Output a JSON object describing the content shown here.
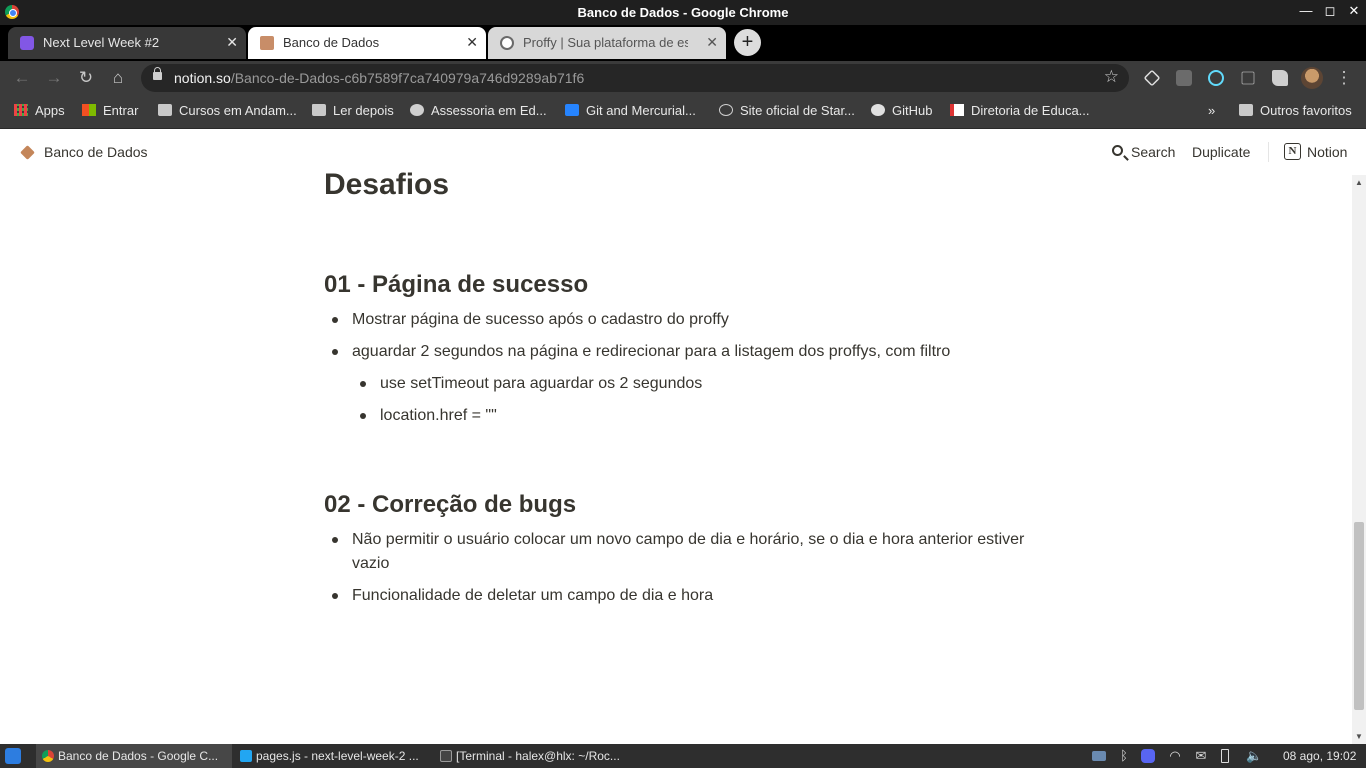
{
  "window": {
    "title": "Banco de Dados - Google Chrome",
    "minimize": "—",
    "maximize": "◻",
    "close": "✕"
  },
  "tabs": [
    {
      "label": "Next Level Week #2",
      "close": "✕"
    },
    {
      "label": "Banco de Dados",
      "close": "✕"
    },
    {
      "label": "Proffy | Sua plataforma de estudos online",
      "close": "✕"
    }
  ],
  "newtab": "+",
  "nav": {
    "back": "←",
    "forward": "→",
    "reload": "↻",
    "home": "⌂",
    "menu": "⋮"
  },
  "omnibox": {
    "domain": "notion.so",
    "path": "/Banco-de-Dados-c6b7589f7ca740979a746d9289ab71f6",
    "star": "☆"
  },
  "bookmarks": [
    {
      "label": "Apps",
      "icon": "apps-grid-icon"
    },
    {
      "label": "Entrar",
      "icon": "microsoft-icon"
    },
    {
      "label": "Cursos em Andam...",
      "icon": "folder-icon"
    },
    {
      "label": "Ler depois",
      "icon": "folder-icon"
    },
    {
      "label": "Assessoria em Ed...",
      "icon": "globe-icon"
    },
    {
      "label": "Git and Mercurial...",
      "icon": "bitbucket-icon"
    },
    {
      "label": "Site oficial de Star...",
      "icon": "star-icon"
    },
    {
      "label": "GitHub",
      "icon": "github-icon"
    },
    {
      "label": "Diretoria de Educa...",
      "icon": "site-icon"
    }
  ],
  "bookmarks_more": "»",
  "other_bookmarks": "Outros favoritos",
  "notion": {
    "page_title": "Banco de Dados",
    "search": "Search",
    "duplicate": "Duplicate",
    "brand": "Notion",
    "brand_letter": "N"
  },
  "content": {
    "title": "Desafios",
    "section1": {
      "heading": "01 - Página de sucesso",
      "items": [
        "Mostrar página de sucesso após o cadastro do proffy",
        "aguardar 2 segundos na página e redirecionar para a listagem dos proffys, com filtro"
      ],
      "subitems": [
        "use setTimeout para aguardar os 2 segundos",
        "location.href = \"\""
      ]
    },
    "section2": {
      "heading": "02 - Correção de bugs",
      "items": [
        "Não permitir o usuário colocar um novo campo de dia e horário, se o dia e hora anterior estiver vazio",
        "Funcionalidade de deletar um campo de dia e hora"
      ]
    }
  },
  "taskbar": {
    "items": [
      {
        "label": "Banco de Dados - Google C..."
      },
      {
        "label": "pages.js - next-level-week-2 ..."
      },
      {
        "label": "[Terminal - halex@hlx: ~/Roc..."
      }
    ],
    "clock": "08 ago, 19:02"
  }
}
